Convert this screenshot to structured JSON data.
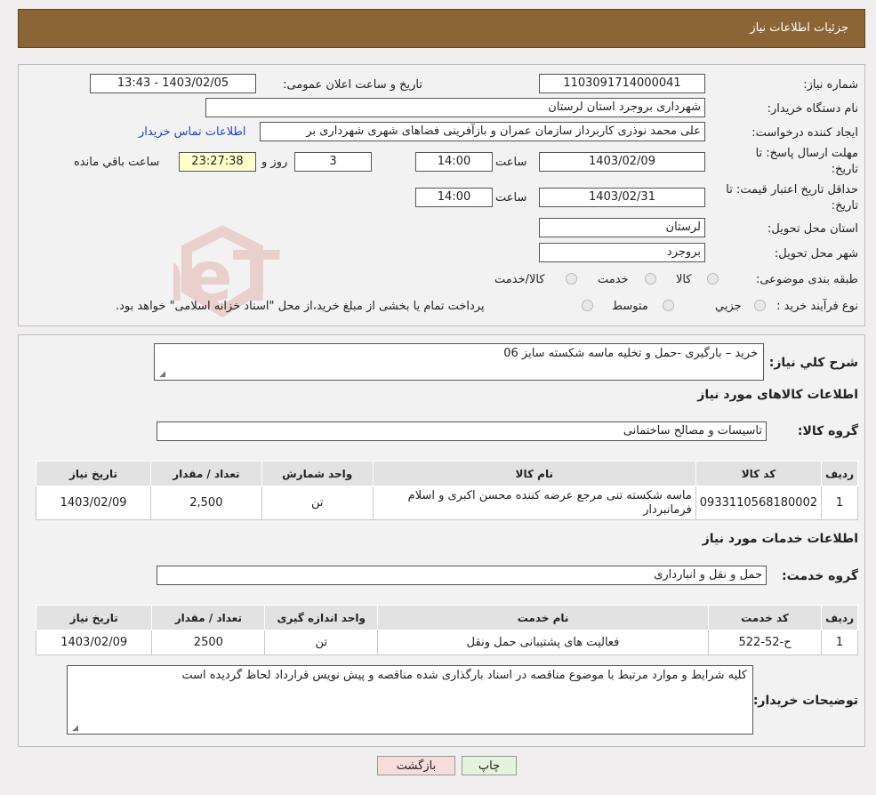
{
  "header": {
    "title": "جزئیات اطلاعات نیاز"
  },
  "form": {
    "need_number_label": "شماره نیاز:",
    "need_number": "1103091714000041",
    "announce_label": "تاریخ و ساعت اعلان عمومی:",
    "announce_value": "1403/02/05 - 13:43",
    "buyer_org_label": "نام دستگاه خریدار:",
    "buyer_org": "شهرداری بروجرد استان لرستان",
    "creator_label": "ایجاد کننده درخواست:",
    "creator": "علی محمد نوذری کاربرداز سازمان عمران و بازآفرینی فضاهای شهری شهرداری بر",
    "contact_link": "اطلاعات تماس خریدار",
    "deadline_label_1": "مهلت ارسال پاسخ: تا",
    "deadline_label_2": "تاریخ:",
    "deadline_date": "1403/02/09",
    "time_label": "ساعت",
    "deadline_time": "14:00",
    "days_value": "3",
    "days_label": "روز و",
    "remaining_time": "23:27:38",
    "remaining_label": "ساعت باقي مانده",
    "validity_label_1": "حداقل تاریخ اعتبار قیمت: تا",
    "validity_label_2": "تاریخ:",
    "validity_date": "1403/02/31",
    "validity_time": "14:00",
    "province_label": "استان محل تحویل:",
    "province": "لرستان",
    "city_label": "شهر محل تحویل:",
    "city": "بروجرد",
    "category_label": "طبقه بندی موضوعی:",
    "category_options": [
      "کالا",
      "خدمت",
      "کالا/خدمت"
    ],
    "process_label": "نوع فرآیند خرید :",
    "process_options": [
      "جزیي",
      "متوسط"
    ],
    "process_note": "پرداخت تمام یا بخشی از مبلغ خرید،از محل \"اسناد خزانه اسلامی\" خواهد بود."
  },
  "description": {
    "label": "شرح کلي نیاز:",
    "value": "خرید – بارگیری -حمل و تخلیه ماسه شکسته سایز 06"
  },
  "goods": {
    "section_title": "اطلاعات کالاهای مورد نیاز",
    "group_label": "گروه کالا:",
    "group_value": "تاسیسات و مصالح ساختمانی",
    "columns": [
      "ردیف",
      "کد کالا",
      "نام کالا",
      "واحد شمارش",
      "تعداد / مقدار",
      "تاریخ نیاز"
    ],
    "rows": [
      {
        "idx": "1",
        "code": "0933110568180002",
        "name": "ماسه شکسته تنی مرجع عرضه کننده محسن اکبری و اسلام فرمانبردار",
        "unit": "تن",
        "qty": "2,500",
        "date": "1403/02/09"
      }
    ]
  },
  "services": {
    "section_title": "اطلاعات خدمات مورد نیاز",
    "group_label": "گروه خدمت:",
    "group_value": "حمل و نقل و انبارداری",
    "columns": [
      "ردیف",
      "کد خدمت",
      "نام خدمت",
      "واحد اندازه گیری",
      "تعداد / مقدار",
      "تاریخ نیاز"
    ],
    "rows": [
      {
        "idx": "1",
        "code": "ح-52-522",
        "name": "فعالیت های پشتیبانی حمل ونقل",
        "unit": "تن",
        "qty": "2500",
        "date": "1403/02/09"
      }
    ]
  },
  "buyer_notes": {
    "label": "توضیحات خریدار:",
    "value": "کلیه شرایط و موارد مرتبط با موضوع مناقصه در اسناد بارگذاری شده مناقصه و پیش نویس قرارداد لحاظ گردیده است"
  },
  "buttons": {
    "print": "چاپ",
    "back": "بازگشت"
  },
  "watermark": {
    "text": "AriaTender.neT"
  },
  "colors": {
    "header": "#8b6535",
    "link": "#1a3fd0",
    "print_btn": "#e4f3dc",
    "back_btn": "#f7dcdc"
  }
}
